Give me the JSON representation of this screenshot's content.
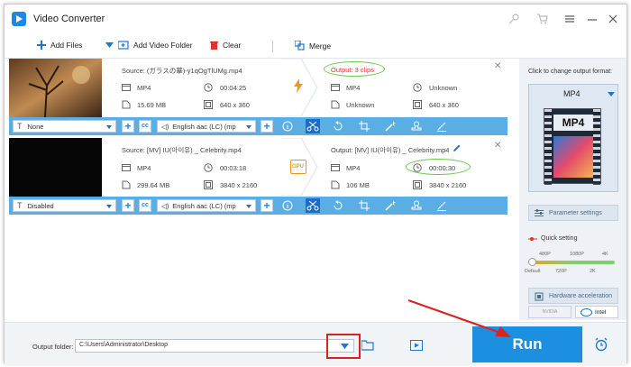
{
  "window": {
    "title": "Video Converter"
  },
  "toolbar": {
    "add_files": "Add Files",
    "add_video_folder": "Add Video Folder",
    "clear": "Clear",
    "merge": "Merge"
  },
  "rows": [
    {
      "source_label": "Source: (ガラスの華)-y1qOgTlUMg.mp4",
      "output_label": "Output: 3 clips",
      "src_format": "MP4",
      "src_duration": "00:04:25",
      "src_size": "15.69 MB",
      "src_resolution": "640 x 360",
      "out_format": "MP4",
      "out_duration": "Unknown",
      "out_size": "Unknown",
      "out_resolution": "640 x 360",
      "subtitle": "None",
      "audio": "English aac (LC) (mp"
    },
    {
      "source_label": "Source: [MV] IU(아이유) _ Celebrity.mp4",
      "output_label": "Output: [MV] IU(아이유) _ Celebrity.mp4",
      "src_format": "MP4",
      "src_duration": "00:03:18",
      "src_size": "299.64 MB",
      "src_resolution": "3840 x 2160",
      "out_format": "MP4",
      "out_duration": "00:00:30",
      "out_size": "106 MB",
      "out_resolution": "3840 x 2160",
      "subtitle": "Disabled",
      "audio": "English aac (LC) (mp",
      "gpu_label": "GPU"
    }
  ],
  "right_panel": {
    "hint": "Click to change output format:",
    "format": "MP4",
    "format_icon_text": "MP4",
    "parameter_settings": "Parameter settings",
    "quick_setting": "Quick setting",
    "q_480": "480P",
    "q_1080": "1080P",
    "q_4k": "4K",
    "q_default": "Default",
    "q_720": "720P",
    "q_2k": "2K",
    "hw_accel": "Hardware acceleration",
    "nvidia": "NVIDIA",
    "intel": "Intel"
  },
  "bottom": {
    "output_folder_label": "Output folder:",
    "output_folder_path": "C:\\Users\\Administrator\\Desktop",
    "run": "Run"
  },
  "colors": {
    "accent_blue": "#5aaee4",
    "run_blue": "#1d8fe1",
    "highlight_green": "#6cc84a",
    "annotation_red": "#d9231f",
    "output_red": "#e5322d"
  }
}
